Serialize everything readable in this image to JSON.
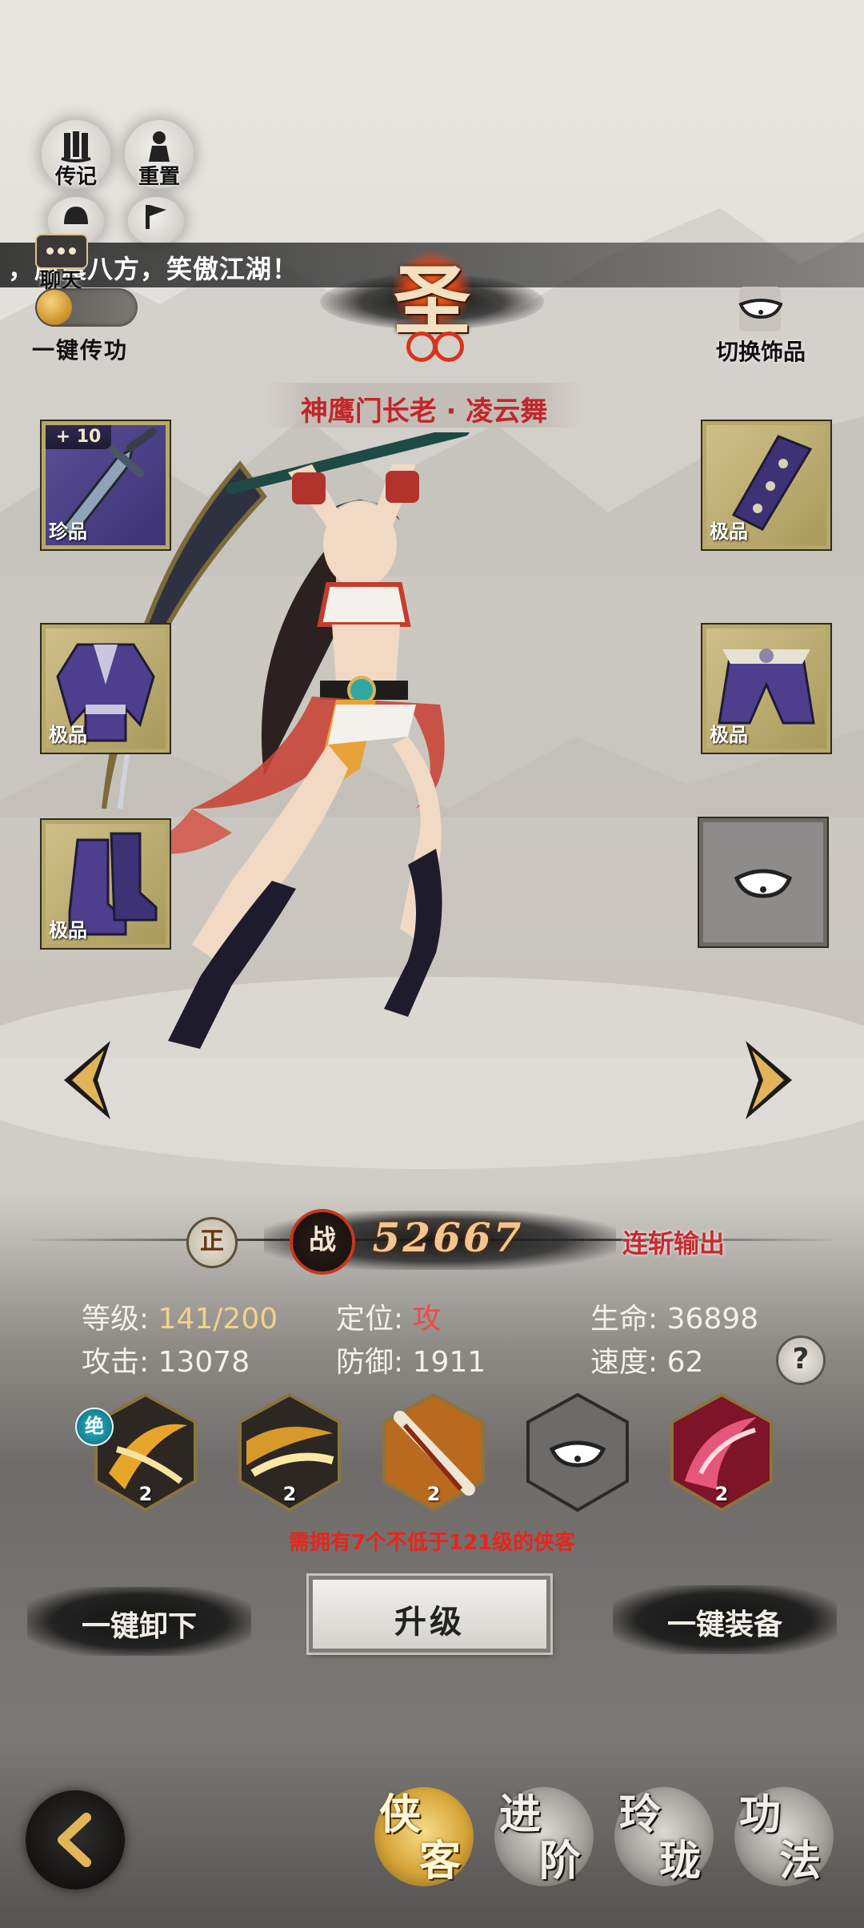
{
  "top_buttons": {
    "biography": "传记",
    "reset": "重置"
  },
  "marquee_text": "，威震八方，笑傲江湖！",
  "chat": {
    "label": "聊天"
  },
  "auto_transfer": {
    "label": "一键传功"
  },
  "rank": {
    "char": "圣"
  },
  "hero": {
    "name": "神鹰门长老 · 凌云舞"
  },
  "switch_accessory": {
    "label": "切换饰品"
  },
  "equipment": {
    "weapon": {
      "quality": "珍品",
      "enhance": "+ 10"
    },
    "armor": {
      "quality": "极品"
    },
    "boots": {
      "quality": "极品"
    },
    "bracer": {
      "quality": "极品"
    },
    "belt": {
      "quality": "极品"
    },
    "accessory": {
      "quality": ""
    }
  },
  "combat": {
    "stance": "正",
    "power_icon": "战",
    "power": "52667",
    "role": "连斩输出"
  },
  "stats": {
    "level_label": "等级: ",
    "level": "141/200",
    "position_label": "定位: ",
    "position": "攻",
    "hp_label": "生命: ",
    "hp": "36898",
    "atk_label": "攻击: ",
    "atk": "13078",
    "def_label": "防御: ",
    "def": "1911",
    "spd_label": "速度: ",
    "spd": "62",
    "help": "?"
  },
  "skills": {
    "ultimate_badge": "绝",
    "levels": [
      "2",
      "2",
      "2",
      "",
      "2"
    ]
  },
  "requirement": "需拥有7个不低于121级的侠客",
  "actions": {
    "unequip_all": "一键卸下",
    "upgrade": "升级",
    "equip_all": "一键装备"
  },
  "nav": {
    "hero": [
      "侠",
      "客"
    ],
    "advance": [
      "进",
      "阶"
    ],
    "linglong": [
      "玲",
      "珑"
    ],
    "kungfu": [
      "功",
      "法"
    ]
  },
  "colors": {
    "name_red": "#c2262a",
    "gold": "#f2d289",
    "epic_purple": "#4a3e86",
    "frame_gold": "#b6a869"
  }
}
